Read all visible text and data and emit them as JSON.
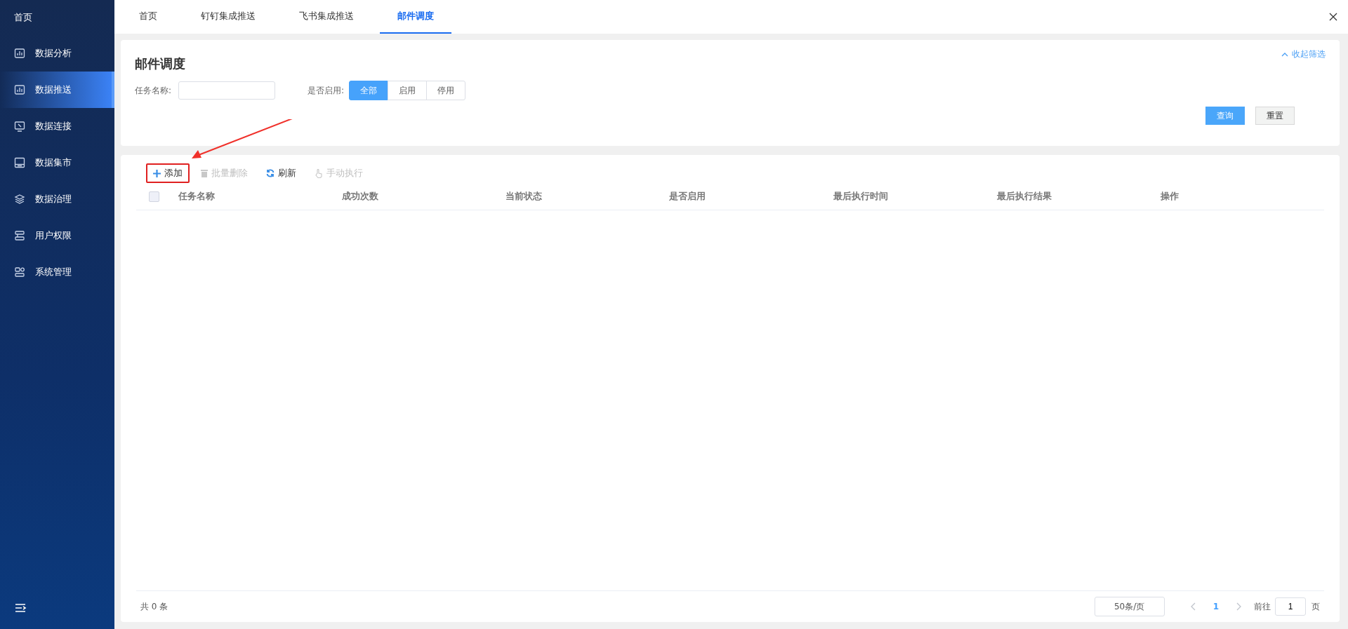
{
  "sidebar": {
    "home": "首页",
    "items": [
      {
        "label": "数据分析",
        "selected": false
      },
      {
        "label": "数据推送",
        "selected": true
      },
      {
        "label": "数据连接",
        "selected": false
      },
      {
        "label": "数据集市",
        "selected": false
      },
      {
        "label": "数据治理",
        "selected": false
      },
      {
        "label": "用户权限",
        "selected": false
      },
      {
        "label": "系统管理",
        "selected": false
      }
    ]
  },
  "tabs": [
    {
      "label": "首页",
      "selected": false
    },
    {
      "label": "钉钉集成推送",
      "selected": false
    },
    {
      "label": "飞书集成推送",
      "selected": false
    },
    {
      "label": "邮件调度",
      "selected": true
    }
  ],
  "filter": {
    "title": "邮件调度",
    "collapse": "收起筛选",
    "task_name": {
      "label": "任务名称:"
    },
    "enabled": {
      "label": "是否启用:",
      "options": [
        {
          "label": "全部",
          "selected": true
        },
        {
          "label": "启用",
          "selected": false
        },
        {
          "label": "停用",
          "selected": false
        }
      ]
    },
    "buttons": [
      {
        "label": "查询",
        "kind": "primary"
      },
      {
        "label": "重置",
        "kind": "default"
      }
    ]
  },
  "toolbar": [
    {
      "kind": "add",
      "label": "添加",
      "disabled": false,
      "highlighted": true
    },
    {
      "kind": "delete",
      "label": "批量删除",
      "disabled": true,
      "highlighted": false
    },
    {
      "kind": "refresh",
      "label": "刷新",
      "disabled": false,
      "highlighted": false
    },
    {
      "kind": "run",
      "label": "手动执行",
      "disabled": true,
      "highlighted": false
    }
  ],
  "table": {
    "select_all": {
      "checked": false
    },
    "columns": [
      "任务名称",
      "成功次数",
      "当前状态",
      "是否启用",
      "最后执行时间",
      "最后执行结果",
      "操作"
    ]
  },
  "pagination": {
    "total": "共 0 条",
    "page_size": "50条/页",
    "current_page": "1",
    "goto_label": "前往",
    "goto_value": "1",
    "goto_suffix": "页"
  }
}
